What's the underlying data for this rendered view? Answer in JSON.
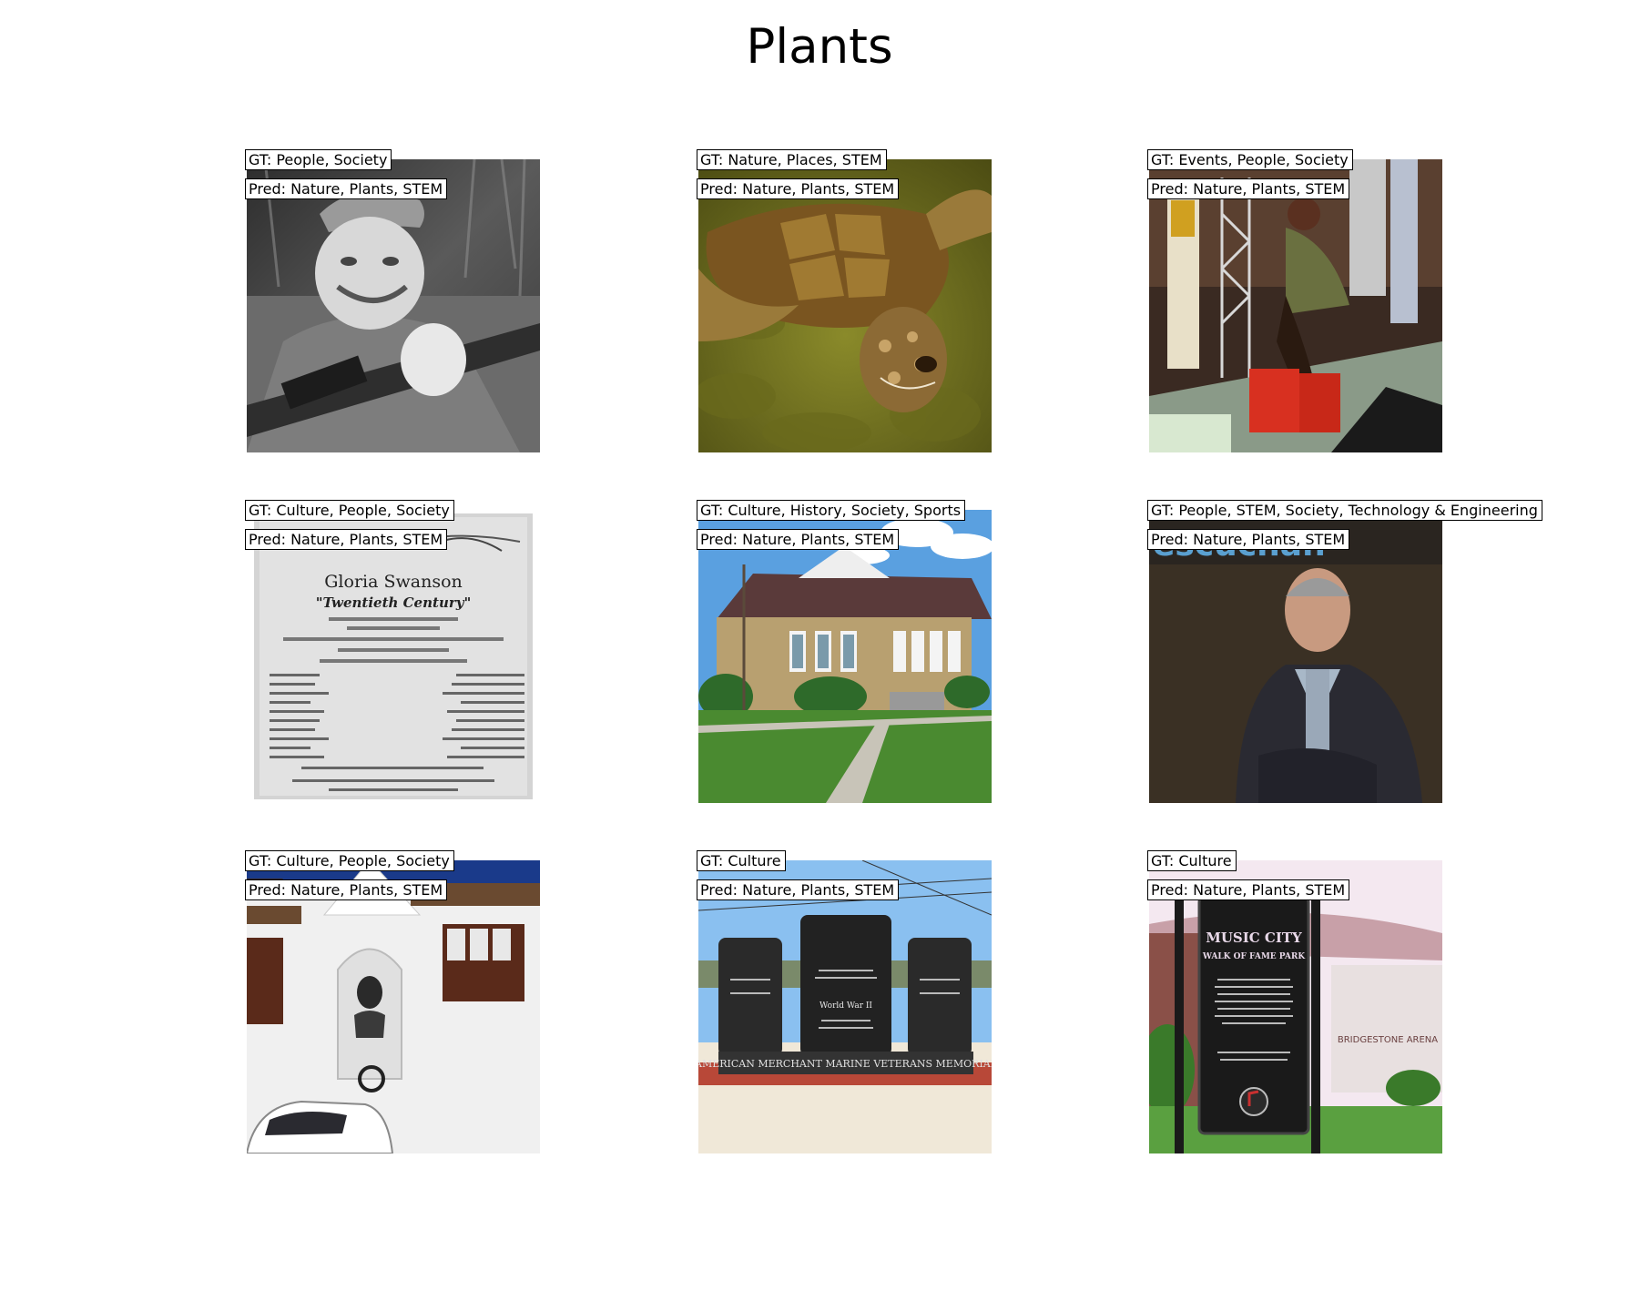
{
  "figure": {
    "title": "Plants"
  },
  "panels": [
    {
      "gt": "GT: People, Society",
      "pred": "Pred: Nature, Plants, STEM",
      "image": "grayscale photo of smiling woman in military cap holding a rifle"
    },
    {
      "gt": "GT: Nature, Places, STEM",
      "pred": "Pred: Nature, Plants, STEM",
      "image": "sea turtle swimming underwater"
    },
    {
      "gt": "GT: Events, People, Society",
      "pred": "Pred: Nature, Plants, STEM",
      "image": "people on a stage with red crates"
    },
    {
      "gt": "GT: Culture, People, Society",
      "pred": "Pred: Nature, Plants, STEM",
      "image": "old theatre program page for Gloria Swanson in Twentieth Century"
    },
    {
      "gt": "GT: Culture, History, Society, Sports",
      "pred": "Pred: Nature, Plants, STEM",
      "image": "brick school building with lawn and sidewalk"
    },
    {
      "gt": "GT: People, STEM, Society, Technology & Engineering",
      "pred": "Pred: Nature, Plants, STEM",
      "image": "man in dark jacket seated in front of a dark backdrop"
    },
    {
      "gt": "GT: Culture, People, Society",
      "pred": "Pred: Nature, Plants, STEM",
      "image": "white building with bust in an arched niche"
    },
    {
      "gt": "GT: Culture",
      "pred": "Pred: Nature, Plants, STEM",
      "image": "black granite memorial stones on sand"
    },
    {
      "gt": "GT: Culture",
      "pred": "Pred: Nature, Plants, STEM",
      "image": "Music City Walk of Fame Park sign"
    }
  ],
  "image_text": {
    "program_name": "Gloria Swanson",
    "program_title": "\"Twentieth Century\"",
    "memorial_text": "AMERICAN MERCHANT MARINE VETERANS MEMORIAL",
    "memorial_center": "World War II",
    "sign_line1": "MUSIC CITY",
    "sign_line2": "WALK OF FAME PARK",
    "arena_text": "BRIDGESTONE ARENA",
    "backdrop_text": "escuchan"
  }
}
